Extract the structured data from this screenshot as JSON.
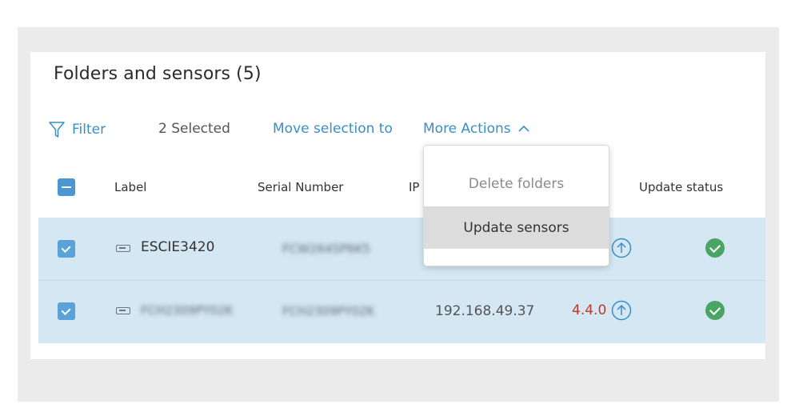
{
  "panel": {
    "title": "Folders and sensors (5)"
  },
  "toolbar": {
    "filter_label": "Filter",
    "selected_count": "2 Selected",
    "move_label": "Move selection to",
    "more_actions_label": "More Actions"
  },
  "table": {
    "columns": {
      "label": "Label",
      "serial": "Serial Number",
      "ip": "IP",
      "update_status": "Update status"
    },
    "rows": [
      {
        "label": "ESCIE3420",
        "serial": "FCW2645P6K5",
        "ip": "",
        "version": ""
      },
      {
        "label": "FCH2309PY02K",
        "serial": "FCH2309PY02K",
        "ip": "192.168.49.37",
        "version": "4.4.0"
      }
    ]
  },
  "more_actions_menu": {
    "items": [
      {
        "label": "Delete folders",
        "state": "disabled"
      },
      {
        "label": "Update sensors",
        "state": "hovered"
      }
    ]
  },
  "colors": {
    "link": "#3b8ec4",
    "checkbox": "#4a97d3",
    "row_selected_bg": "#d4e7f3",
    "version_text": "#c0392b",
    "status_ok": "#4aa564"
  },
  "icons": [
    "filter-icon",
    "chevron-up-icon",
    "sensor-device-icon",
    "upload-arrow-icon",
    "check-circle-icon"
  ]
}
